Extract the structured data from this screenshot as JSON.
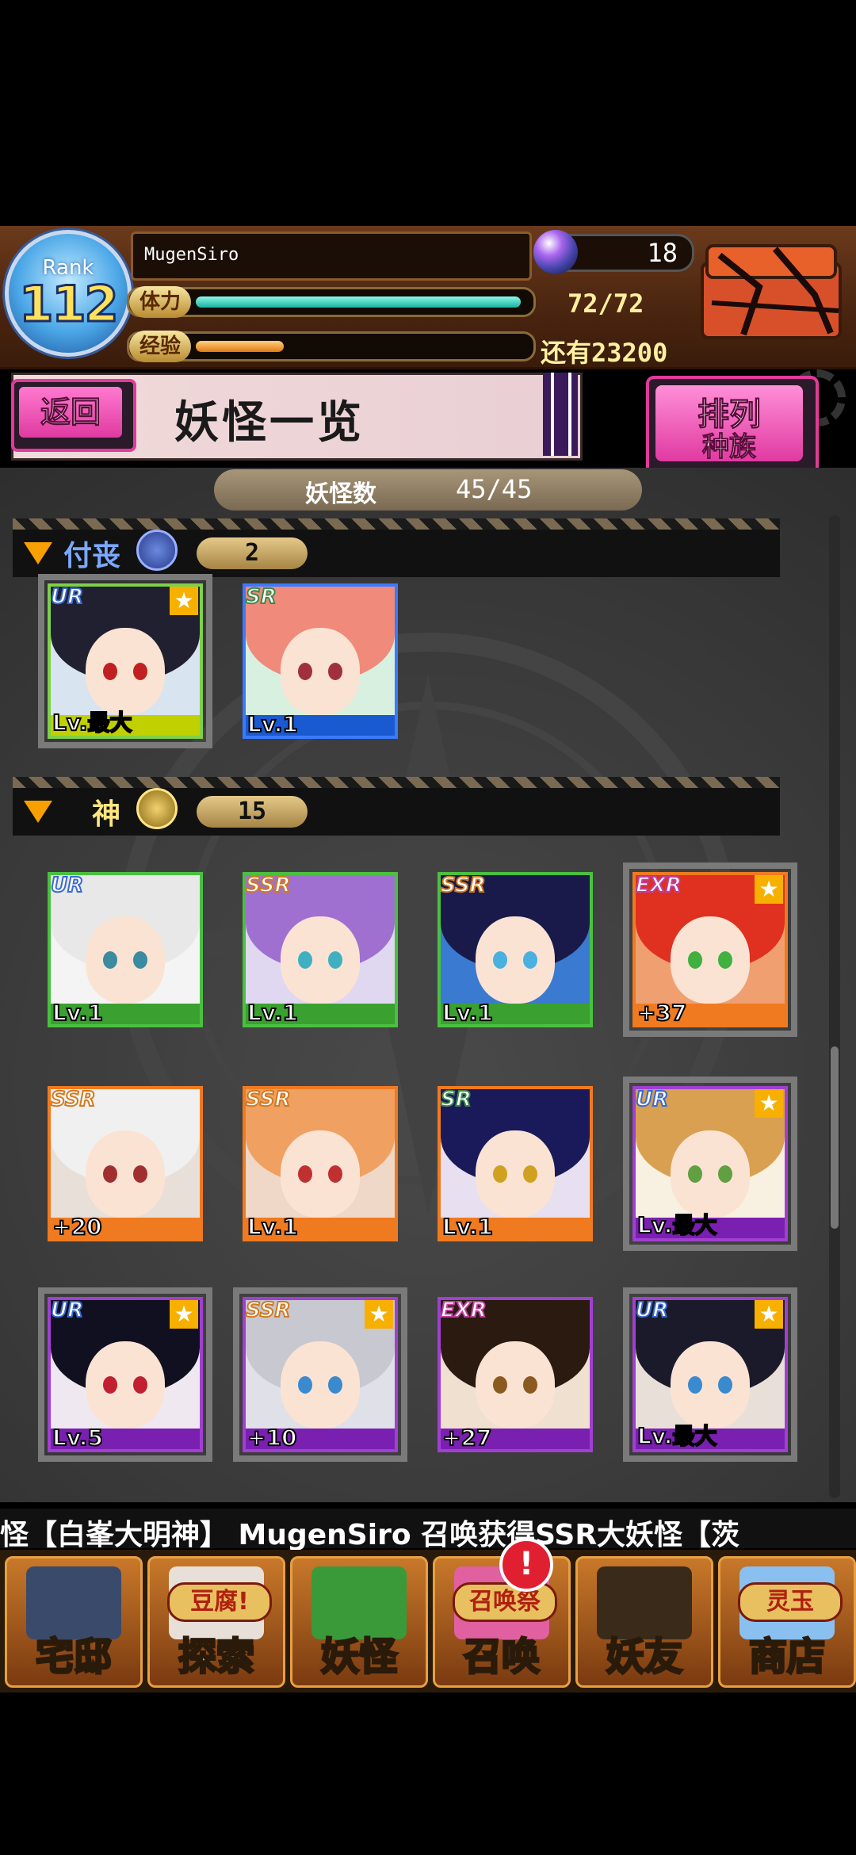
{
  "player": {
    "rank_label": "Rank",
    "rank": "112",
    "name": "MugenSiro",
    "stamina_label": "体力",
    "stamina_text": "72/72",
    "stamina_fraction": 1.0,
    "exp_label": "经验",
    "exp_text": "还有23200",
    "exp_fraction": 0.27,
    "orb_count": "18"
  },
  "header": {
    "back_label": "返回",
    "title": "妖怪一览",
    "sort_label_1": "排列",
    "sort_label_2": "种族"
  },
  "monster_count": {
    "label": "妖怪数",
    "value": "45/45"
  },
  "sections": [
    {
      "name": "付丧",
      "name_color": "#7aa8ff",
      "count": "2",
      "cards": [
        {
          "rarity": "UR",
          "level": "Lv.最大",
          "frame": "#7fd04a",
          "bottom": "#c0d000",
          "bg": "#d8e4f0",
          "hair": "#202030",
          "eye": "#c02020",
          "star": true
        },
        {
          "rarity": "SR",
          "level": "Lv.1",
          "frame": "#3a7aff",
          "bottom": "#1a5ad0",
          "bg": "#d8f0e0",
          "hair": "#f08a7a",
          "eye": "#a03040",
          "star": false
        }
      ]
    },
    {
      "name": "神",
      "name_color": "#ffe680",
      "count": "15",
      "cards": [
        {
          "rarity": "UR",
          "level": "Lv.1",
          "frame": "#4ac040",
          "bottom": "#3aa030",
          "bg": "#f4f4f4",
          "hair": "#e8e8e8",
          "eye": "#3a8aa0",
          "star": false
        },
        {
          "rarity": "SSR",
          "level": "Lv.1",
          "frame": "#4ac040",
          "bottom": "#3aa030",
          "bg": "#e0d8f0",
          "hair": "#a070d0",
          "eye": "#40b0c0",
          "star": false
        },
        {
          "rarity": "SSR",
          "level": "Lv.1",
          "frame": "#4ac040",
          "bottom": "#3aa030",
          "bg": "#3a7ad0",
          "hair": "#1a1a4a",
          "eye": "#4ab0e0",
          "star": false
        },
        {
          "rarity": "EXR",
          "level": "+37",
          "frame": "#f07a20",
          "bottom": "#f07a20",
          "bg": "#f0a070",
          "hair": "#e03020",
          "eye": "#40b040",
          "star": true
        },
        {
          "rarity": "SSR",
          "level": "+20",
          "frame": "#f07a20",
          "bottom": "#f07a20",
          "bg": "#e8e0d8",
          "hair": "#f0f0f0",
          "eye": "#a03030",
          "star": false
        },
        {
          "rarity": "SSR",
          "level": "Lv.1",
          "frame": "#f07a20",
          "bottom": "#f07a20",
          "bg": "#f0d8c8",
          "hair": "#f0a060",
          "eye": "#c03030",
          "star": false
        },
        {
          "rarity": "SR",
          "level": "Lv.1",
          "frame": "#f07a20",
          "bottom": "#f07a20",
          "bg": "#e8e0f0",
          "hair": "#1a1a5a",
          "eye": "#d0a020",
          "star": false
        },
        {
          "rarity": "UR",
          "level": "Lv.最大",
          "frame": "#a040d0",
          "bottom": "#7a20b0",
          "bg": "#f8f0e0",
          "hair": "#d8a050",
          "eye": "#60a040",
          "star": true
        },
        {
          "rarity": "UR",
          "level": "Lv.5",
          "frame": "#a040d0",
          "bottom": "#7a20b0",
          "bg": "#f0e8f0",
          "hair": "#101020",
          "eye": "#c02030",
          "star": true
        },
        {
          "rarity": "SSR",
          "level": "+10",
          "frame": "#a040d0",
          "bottom": "#7a20b0",
          "bg": "#e0e0e8",
          "hair": "#c8c8d0",
          "eye": "#3a8ad0",
          "star": true
        },
        {
          "rarity": "EXR",
          "level": "+27",
          "frame": "#a040d0",
          "bottom": "#7a20b0",
          "bg": "#f0e0d0",
          "hair": "#2a1a10",
          "eye": "#8a5a20",
          "star": false
        },
        {
          "rarity": "UR",
          "level": "Lv.最大",
          "frame": "#a040d0",
          "bottom": "#7a20b0",
          "bg": "#e8e0d8",
          "hair": "#1a1a2a",
          "eye": "#3a8ad0",
          "star": true
        }
      ]
    }
  ],
  "ticker": {
    "text": "怪【白峯大明神】    MugenSiro 召唤获得SSR大妖怪【茨"
  },
  "nav": [
    {
      "label": "宅邸",
      "icon": "house-icon",
      "art": "#3a4a6a"
    },
    {
      "label": "探索",
      "icon": "tofu-icon",
      "badge": "豆腐!",
      "art": "#e8e0d8"
    },
    {
      "label": "妖怪",
      "icon": "scroll-icon",
      "art": "#3a9a3a"
    },
    {
      "label": "召唤",
      "icon": "summon-icon",
      "badge": "召唤祭",
      "art": "#e060a0"
    },
    {
      "label": "妖友",
      "icon": "friend-icon",
      "art": "#3a2a1a"
    },
    {
      "label": "商店",
      "icon": "spirit-orb-icon",
      "badge": "灵玉",
      "art": "#8ac0f0"
    }
  ],
  "nav_alert": "!",
  "colors": {
    "accent_pink": "#e03aa0",
    "gold": "#ffe25a",
    "stamina": "#3ad8c0",
    "exp": "#f0a030"
  }
}
